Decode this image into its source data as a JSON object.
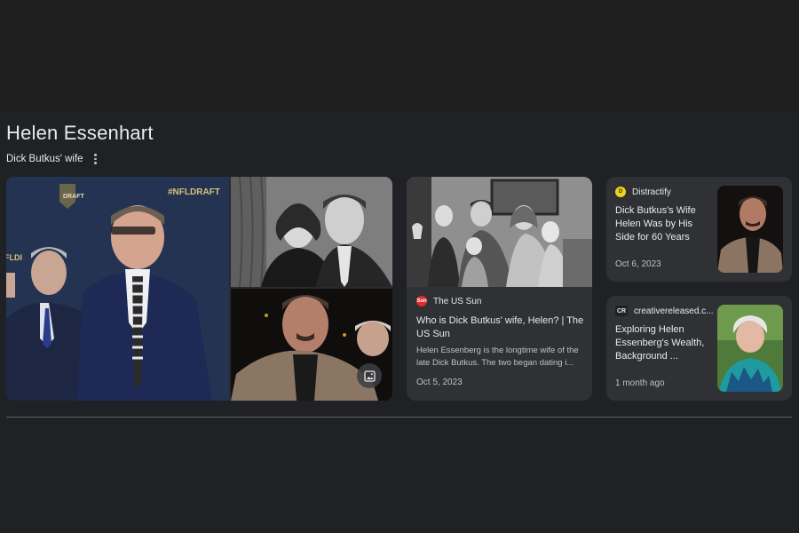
{
  "entity": {
    "title": "Helen Essenhart",
    "subtitle": "Dick Butkus' wife"
  },
  "cards": [
    {
      "source": "The US Sun",
      "favicon_text": "Sun",
      "favicon_color": "#e32b2b",
      "title": "Who is Dick Butkus' wife, Helen? | The US Sun",
      "snippet": "Helen Essenberg is the longtime wife of the late Dick Butkus. The two began dating i...",
      "date": "Oct 5, 2023"
    },
    {
      "source": "Distractify",
      "favicon_text": "D",
      "favicon_color": "#f2d21b",
      "title": "Dick Butkus's Wife Helen Was by His Side for 60 Years",
      "date": "Oct 6, 2023"
    },
    {
      "source": "creativereleased.c...",
      "favicon_text": "CR",
      "favicon_color": "#202124",
      "title": "Exploring Helen Essenberg's Wealth, Background ...",
      "date": "1 month ago"
    }
  ],
  "collage": {
    "badge_left": "DRAFT",
    "badge_right": "#NFLDRAFT",
    "partial_text": "FLDI"
  },
  "colors": {
    "background": "#202124",
    "card": "#303134",
    "text_primary": "#e8eaed",
    "text_secondary": "#bdc1c6"
  }
}
